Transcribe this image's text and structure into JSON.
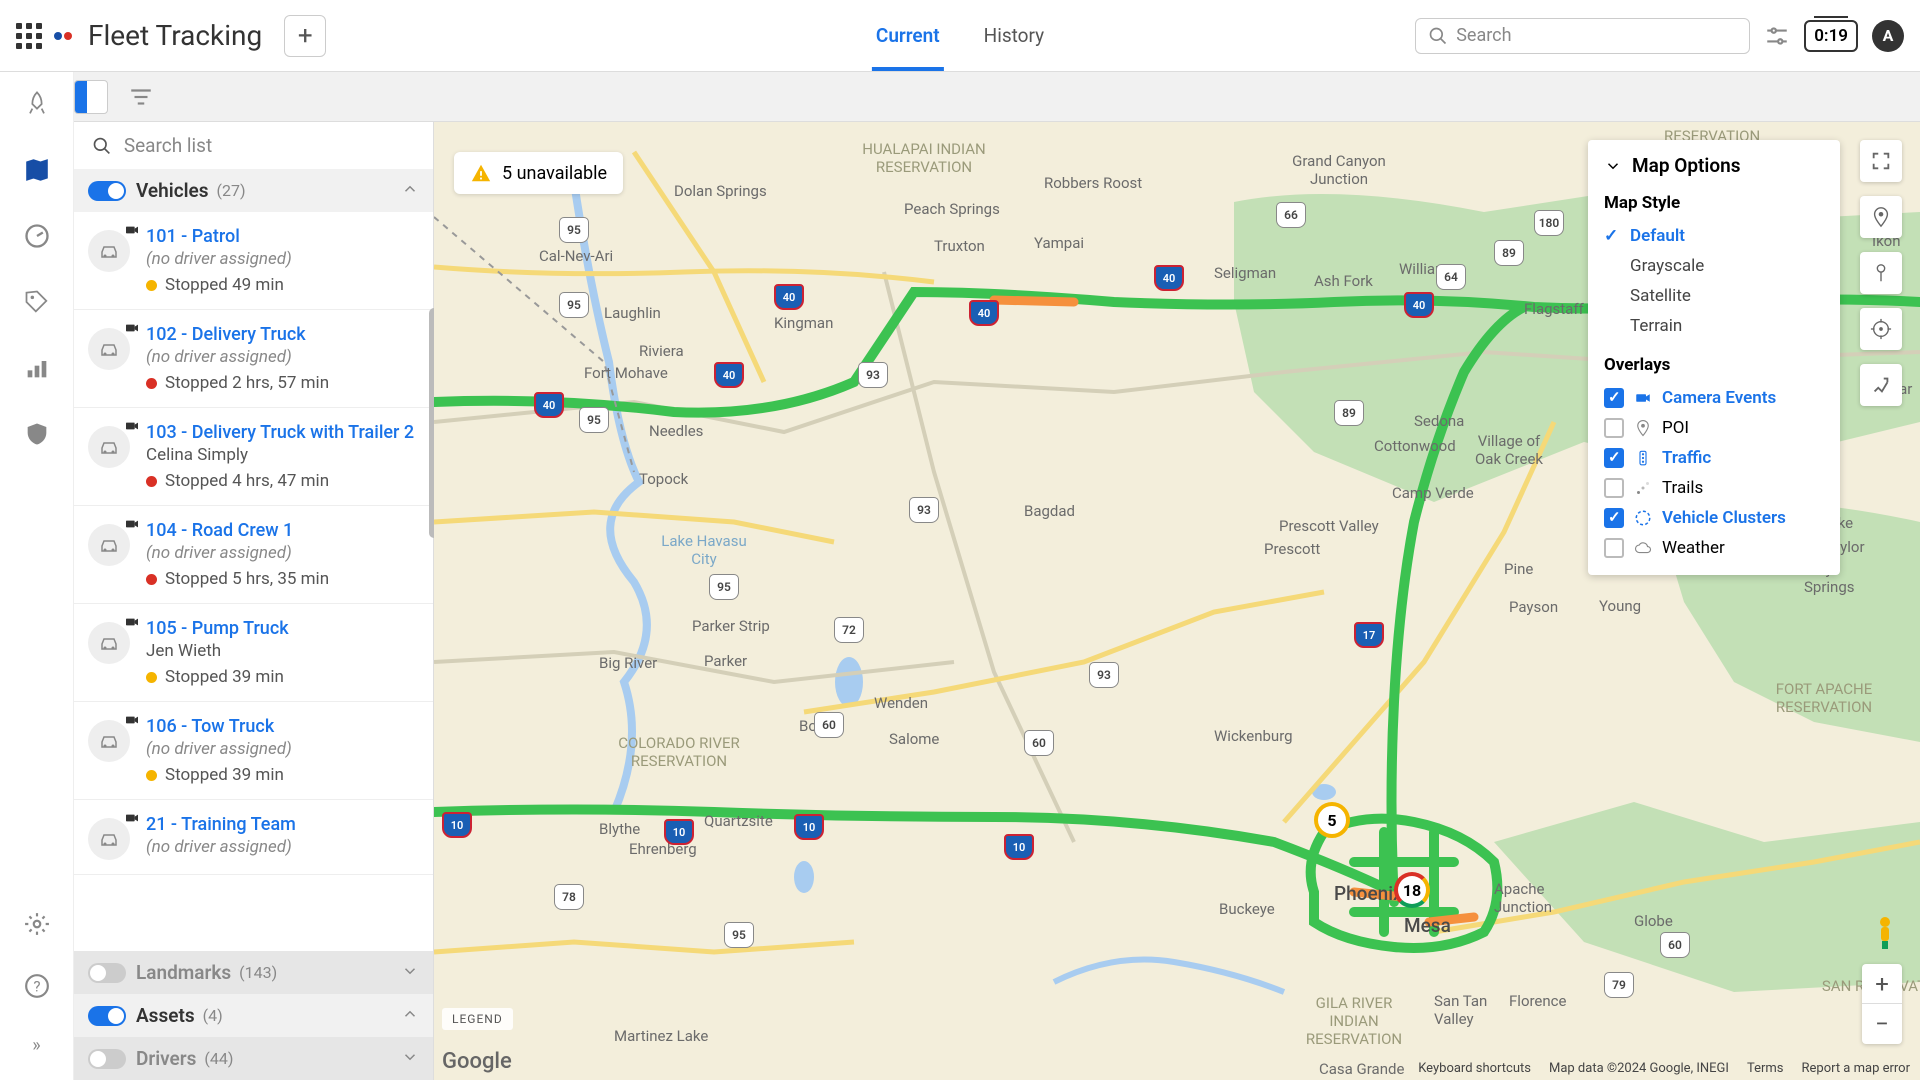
{
  "app": {
    "title": "Fleet Tracking",
    "avatar_initial": "A",
    "time_badge": "0:19"
  },
  "tabs": {
    "current": "Current",
    "history": "History"
  },
  "search": {
    "placeholder": "Search",
    "list_placeholder": "Search list"
  },
  "sections": {
    "vehicles": {
      "label": "Vehicles",
      "count": "(27)"
    },
    "landmarks": {
      "label": "Landmarks",
      "count": "(143)"
    },
    "assets": {
      "label": "Assets",
      "count": "(4)"
    },
    "drivers": {
      "label": "Drivers",
      "count": "(44)"
    }
  },
  "vehicles": [
    {
      "name": "101 - Patrol",
      "driver": "(no driver assigned)",
      "status": "Stopped 49 min",
      "dot": "yellow",
      "driver_named": false
    },
    {
      "name": "102 - Delivery Truck",
      "driver": "(no driver assigned)",
      "status": "Stopped 2 hrs, 57 min",
      "dot": "red",
      "driver_named": false
    },
    {
      "name": "103 - Delivery Truck with Trailer 2",
      "driver": "Celina Simply",
      "status": "Stopped 4 hrs, 47 min",
      "dot": "red",
      "driver_named": true
    },
    {
      "name": "104 - Road Crew 1",
      "driver": "(no driver assigned)",
      "status": "Stopped 5 hrs, 35 min",
      "dot": "red",
      "driver_named": false
    },
    {
      "name": "105 - Pump Truck",
      "driver": "Jen Wieth",
      "status": "Stopped 39 min",
      "dot": "yellow",
      "driver_named": true
    },
    {
      "name": "106 - Tow Truck",
      "driver": "(no driver assigned)",
      "status": "Stopped 39 min",
      "dot": "yellow",
      "driver_named": false
    },
    {
      "name": "21 - Training Team",
      "driver": "(no driver assigned)",
      "status": "",
      "dot": "yellow",
      "driver_named": false
    }
  ],
  "map": {
    "unavailable": "5 unavailable",
    "legend": "LEGEND",
    "google": "Google",
    "cluster5": "5",
    "cluster18": "18",
    "credits": {
      "shortcuts": "Keyboard shortcuts",
      "data": "Map data ©2024 Google, INEGI",
      "terms": "Terms",
      "report": "Report a map error"
    }
  },
  "map_options": {
    "title": "Map Options",
    "style_hdr": "Map Style",
    "styles": {
      "default": "Default",
      "grayscale": "Grayscale",
      "satellite": "Satellite",
      "terrain": "Terrain"
    },
    "overlays_hdr": "Overlays",
    "overlays": {
      "camera": "Camera Events",
      "poi": "POI",
      "traffic": "Traffic",
      "trails": "Trails",
      "clusters": "Vehicle Clusters",
      "weather": "Weather"
    }
  },
  "labels": {
    "phoenix": "Phoenix",
    "mesa": "Mesa",
    "flagstaff": "Flagstaff",
    "kingman": "Kingman",
    "prescott": "Prescott",
    "prescott_valley": "Prescott Valley",
    "sedona": "Sedona",
    "laughlin": "Laughlin",
    "needles": "Needles",
    "blythe": "Blythe",
    "buckeye": "Buckeye",
    "camp_verde": "Camp Verde",
    "cottonwood": "Cottonwood",
    "payson": "Payson",
    "florence": "Florence",
    "casa_grande": "Casa Grande",
    "globe": "Globe",
    "wickenburg": "Wickenburg",
    "quartzsite": "Quartzsite",
    "parker": "Parker",
    "parker_strip": "Parker Strip",
    "big_river": "Big River",
    "bouse": "Bouse",
    "salome": "Salome",
    "wenden": "Wenden",
    "bagdad": "Bagdad",
    "seligman": "Seligman",
    "ash_fork": "Ash Fork",
    "williams": "Williams",
    "topock": "Topock",
    "fort_mohave": "Fort Mohave",
    "cal_nev_ari": "Cal-Nev-Ari",
    "dolan_springs": "Dolan Springs",
    "peach_springs": "Peach Springs",
    "truxton": "Truxton",
    "yampai": "Yampai",
    "robbers_roost": "Robbers Roost",
    "riviera": "Riviera",
    "ehrenberg": "Ehrenberg",
    "pine": "Pine",
    "young": "Young",
    "snowflake": "Snowflake",
    "san_tan_valley": "San Tan Valley",
    "eagar": "Eagar",
    "apache_junction": "Apache Junction",
    "oak_creek": "Village of\nOak Creek",
    "grand_canyon_j": "Grand Canyon\nJunction",
    "martinez_lake": "Martinez Lake",
    "ikon": "Ikon",
    "taylor": "Taylor",
    "clay_springs": "Clay Springs",
    "havasu": "Lake\nHavasu City",
    "hualapai": "HUALAPAI INDIAN\nRESERVATION",
    "colorado_river": "COLORADO RIVER\nRESERVATION",
    "gila_river": "GILA RIVER\nINDIAN\nRESERVATION",
    "fort_apache": "FORT APACHE\nRESERVATION",
    "san_carlos": "SAN\nRESERVAT",
    "reservation_ne": "RESERVATION"
  }
}
